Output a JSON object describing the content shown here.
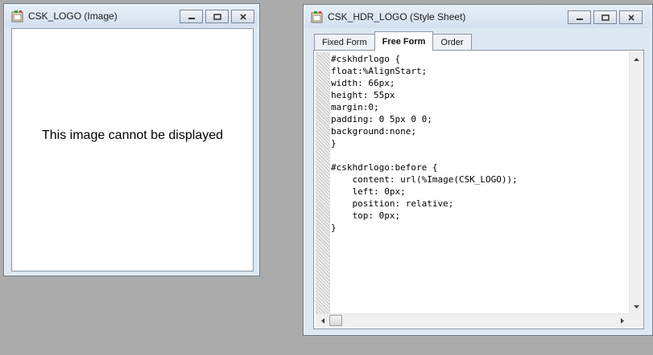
{
  "image_window": {
    "title": "CSK_LOGO (Image)",
    "message": "This image cannot be displayed"
  },
  "stylesheet_window": {
    "title": "CSK_HDR_LOGO (Style Sheet)",
    "tabs": [
      {
        "label": "Fixed Form"
      },
      {
        "label": "Free Form"
      },
      {
        "label": "Order"
      }
    ],
    "active_tab": "Free Form",
    "code_lines": [
      "#cskhdrlogo {",
      "float:%AlignStart;",
      "width: 66px;",
      "height: 55px",
      "margin:0;",
      "padding: 0 5px 0 0;",
      "background:none;",
      "}",
      "",
      "#cskhdrlogo:before {",
      "    content: url(%Image(CSK_LOGO));",
      "    left: 0px;",
      "    position: relative;",
      "    top: 0px;",
      "}"
    ]
  },
  "icons": {
    "title_icon": "window-app-icon",
    "minimize": "minimize-icon",
    "maximize": "maximize-icon",
    "close": "close-icon"
  },
  "colors": {
    "desktop": "#ababab",
    "window_frame": "#dde8f3",
    "editor_background": "#ffffff"
  }
}
